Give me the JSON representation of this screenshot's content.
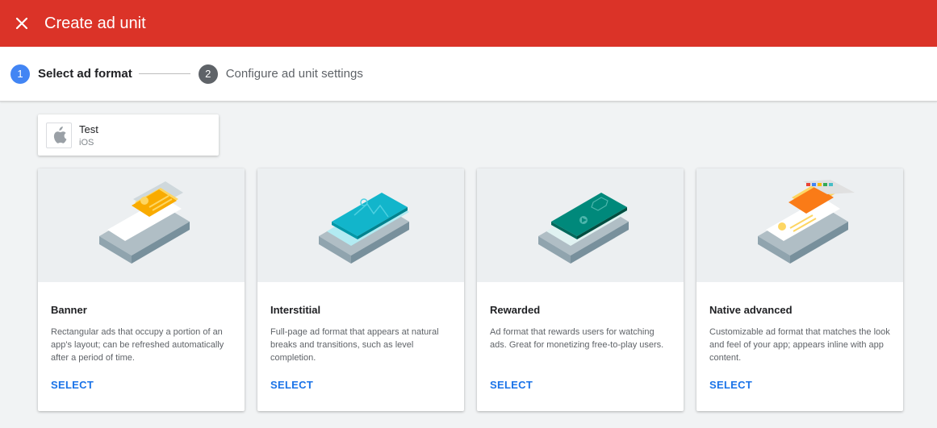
{
  "topbar": {
    "title": "Create ad unit",
    "close_icon": "close-icon",
    "color": "#db3328"
  },
  "stepper": {
    "steps": [
      {
        "number": "1",
        "label": "Select ad format",
        "state": "active"
      },
      {
        "number": "2",
        "label": "Configure ad unit settings",
        "state": "inactive"
      }
    ],
    "active_color": "#4285f4"
  },
  "app": {
    "name": "Test",
    "platform": "iOS",
    "icon": "apple-icon"
  },
  "formats": [
    {
      "title": "Banner",
      "description": "Rectangular ads that occupy a portion of an app's layout; can be refreshed automatically after a period of time.",
      "action": "SELECT",
      "illustration": "banner-illustration-icon"
    },
    {
      "title": "Interstitial",
      "description": "Full-page ad format that appears at natural breaks and transitions, such as level completion.",
      "action": "SELECT",
      "illustration": "interstitial-illustration-icon"
    },
    {
      "title": "Rewarded",
      "description": "Ad format that rewards users for watching ads. Great for monetizing free-to-play users.",
      "action": "SELECT",
      "illustration": "rewarded-illustration-icon"
    },
    {
      "title": "Native advanced",
      "description": "Customizable ad format that matches the look and feel of your app; appears inline with app content.",
      "action": "SELECT",
      "illustration": "native-advanced-illustration-icon"
    }
  ],
  "colors": {
    "link": "#1a73e8",
    "banner": "#f9ab00",
    "interstitial": "#12b5cb",
    "rewarded": "#00897b",
    "native": "#fa7b17"
  }
}
